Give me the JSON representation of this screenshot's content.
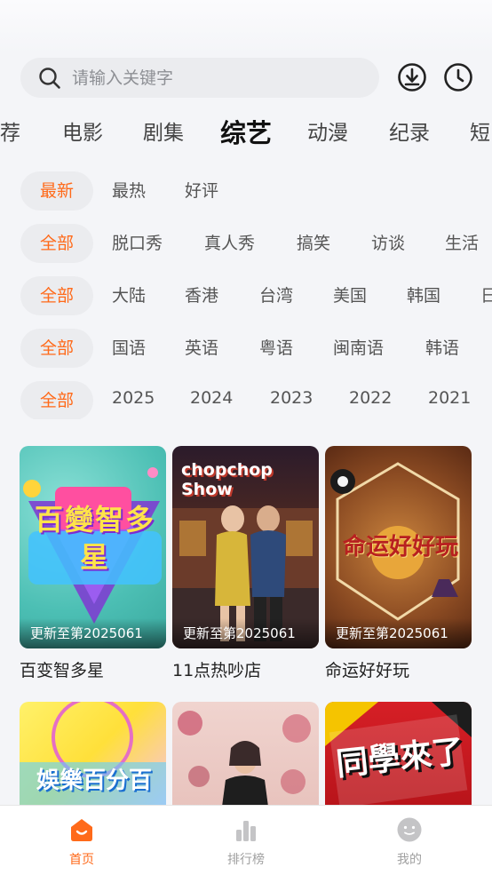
{
  "search": {
    "placeholder": "请输入关键字"
  },
  "top_icons": [
    "download-icon",
    "history-icon"
  ],
  "categories": [
    "荐",
    "电影",
    "剧集",
    "综艺",
    "动漫",
    "纪录",
    "短"
  ],
  "active_category": "综艺",
  "filters": {
    "sort": [
      "最新",
      "最热",
      "好评"
    ],
    "type": [
      "全部",
      "脱口秀",
      "真人秀",
      "搞笑",
      "访谈",
      "生活"
    ],
    "region": [
      "全部",
      "大陆",
      "香港",
      "台湾",
      "美国",
      "韩国",
      "日"
    ],
    "language": [
      "全部",
      "国语",
      "英语",
      "粤语",
      "闽南语",
      "韩语"
    ],
    "year": [
      "全部",
      "2025",
      "2024",
      "2023",
      "2022",
      "2021"
    ]
  },
  "cards": [
    {
      "title": "百变智多星",
      "update": "更新至第2025061",
      "poster_text": "百變智多星"
    },
    {
      "title": "11点热吵店",
      "update": "更新至第2025061",
      "poster_text": "chopchop Show"
    },
    {
      "title": "命运好好玩",
      "update": "更新至第2025061",
      "poster_text": "命运好好玩"
    }
  ],
  "cards_row2": [
    {
      "poster_text": "娛樂百分百"
    },
    {
      "poster_text": ""
    },
    {
      "poster_text": "同學來了"
    }
  ],
  "bottom_nav": [
    {
      "label": "首页",
      "icon": "home-icon",
      "active": true
    },
    {
      "label": "排行榜",
      "icon": "chart-icon",
      "active": false
    },
    {
      "label": "我的",
      "icon": "profile-icon",
      "active": false
    }
  ],
  "colors": {
    "accent": "#ff6a1a",
    "chip_bg": "#ebecef",
    "background": "#f4f5f8"
  }
}
